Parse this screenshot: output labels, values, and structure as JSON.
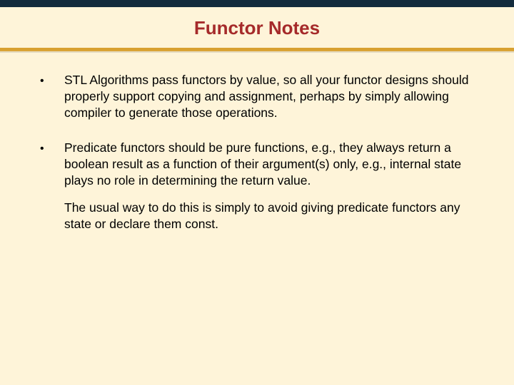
{
  "title": "Functor Notes",
  "bullets": [
    {
      "marker": "•",
      "text": "STL Algorithms pass functors by value, so all your functor designs should properly support copying and assignment, perhaps by simply allowing compiler to generate those operations."
    },
    {
      "marker": "•",
      "text": "Predicate functors should be pure functions, e.g., they always return a boolean result as a function of their argument(s) only, e.g., internal state plays no role in determining the return value.",
      "sub": "The usual way to do this is simply to avoid giving predicate functors any state or declare them const."
    }
  ]
}
